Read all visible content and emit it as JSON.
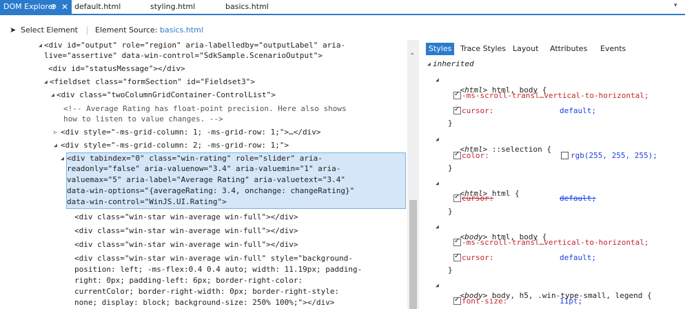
{
  "tabs": {
    "active": "DOM Explorer",
    "pin": "⊕",
    "close": "✕",
    "files": [
      "default.html",
      "styling.html",
      "basics.html"
    ]
  },
  "toolbar": {
    "select_element": "Select Element",
    "element_source_label": "Element Source:",
    "element_source_file": "basics.html"
  },
  "dom_lines": [
    "<div id=\"output\" role=\"region\" aria-labelledby=\"outputLabel\" aria-",
    "live=\"assertive\" data-win-control=\"SdkSample.ScenarioOutput\">",
    "<div id=\"statusMessage\"></div>",
    "<fieldset class=\"formSection\" id=\"Fieldset3\">",
    "<div class=\"twoColumnGridContainer-ControlList\">",
    "<!-- Average Rating has float-point precision. Here also shows",
    "how to listen to value changes. -->",
    "<div style=\"-ms-grid-column: 1; -ms-grid-row: 1;\">…</div>",
    "<div style=\"-ms-grid-column: 2; -ms-grid-row: 1;\">",
    "<div tabindex=\"0\" class=\"win-rating\" role=\"slider\" aria-",
    "readonly=\"false\" aria-valuenow=\"3.4\" aria-valuemin=\"1\" aria-",
    "valuemax=\"5\" aria-label=\"Average Rating\" aria-valuetext=\"3.4\"",
    "data-win-options=\"{averageRating: 3.4, onchange: changeRating}\"",
    "data-win-control=\"WinJS.UI.Rating\">",
    "<div class=\"win-star win-average win-full\"></div>",
    "<div class=\"win-star win-average win-full\"></div>",
    "<div class=\"win-star win-average win-full\"></div>",
    "<div class=\"win-star win-average win-full\" style=\"background-",
    "position: left; -ms-flex:0.4 0.4 auto; width: 11.19px; padding-",
    "right: 0px; padding-left: 6px; border-right-color:",
    "currentColor; border-right-width: 0px; border-right-style:",
    "none; display: block; background-size: 250% 100%;\"></div>"
  ],
  "styles_tabs": [
    "Styles",
    "Trace Styles",
    "Layout",
    "Attributes",
    "Events"
  ],
  "styles": {
    "inherited": "inherited",
    "r1_tag": "<html>",
    "r1_sel": " html, body {",
    "r1_p1_name": "-ms-scroll-transl…vertical-to-horizontal;",
    "r1_p2_name": "cursor:",
    "r1_p2_val": "default;",
    "close": "}",
    "r2_tag": "<html>",
    "r2_sel": " ::selection {",
    "r2_p1_name": "color:",
    "r2_p1_val": "rgb(255, 255, 255);",
    "r3_tag": "<html>",
    "r3_sel": " html {",
    "r3_p1_name": "cursor:",
    "r3_p1_val": "default;",
    "r4_tag": "<body>",
    "r4_sel": " html, body {",
    "r4_p1_name": "-ms-scroll-transl…vertical-to-horizontal;",
    "r4_p2_name": "cursor:",
    "r4_p2_val": "default;",
    "r5_tag": "<body>",
    "r5_sel": " body, h5, .win-type-small, legend {",
    "r5_p1_name": "font-size:",
    "r5_p1_val": "11pt;"
  },
  "colors": {
    "accent": "#2b7bcc",
    "selection_bg": "#d4e6f7",
    "tag": "#1f377f",
    "attr_name": "#b8312f",
    "attr_value": "#1a3ee6",
    "swatch": "#ffffff"
  }
}
